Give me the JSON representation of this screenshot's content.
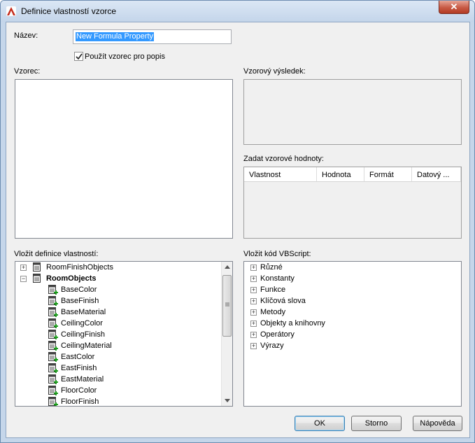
{
  "window": {
    "title": "Definice vlastností vzorce",
    "close_symbol": "✕",
    "accent": "#c42b1c"
  },
  "name_field": {
    "label": "Název:",
    "value": "New Formula Property"
  },
  "use_formula_checkbox": {
    "label": "Použít vzorec pro popis",
    "checked": true
  },
  "formula": {
    "label": "Vzorec:"
  },
  "sample_result": {
    "label": "Vzorový výsledek:"
  },
  "sample_values": {
    "label": "Zadat vzorové hodnoty:",
    "columns": [
      "Vlastnost",
      "Hodnota",
      "Formát",
      "Datový ..."
    ]
  },
  "insert_property_definitions": {
    "label": "Vložit definice vlastností:",
    "groups": [
      {
        "label": "RoomFinishObjects",
        "expanded": false,
        "bold": false
      },
      {
        "label": "RoomObjects",
        "expanded": true,
        "bold": true
      }
    ],
    "children": [
      "BaseColor",
      "BaseFinish",
      "BaseMaterial",
      "CeilingColor",
      "CeilingFinish",
      "CeilingMaterial",
      "EastColor",
      "EastFinish",
      "EastMaterial",
      "FloorColor",
      "FloorFinish"
    ]
  },
  "insert_vbscript": {
    "label": "Vložit kód VBScript:",
    "items": [
      "Různé",
      "Konstanty",
      "Funkce",
      "Klíčová slova",
      "Metody",
      "Objekty a knihovny",
      "Operátory",
      "Výrazy"
    ]
  },
  "buttons": {
    "ok": "OK",
    "cancel": "Storno",
    "help": "Nápověda"
  }
}
